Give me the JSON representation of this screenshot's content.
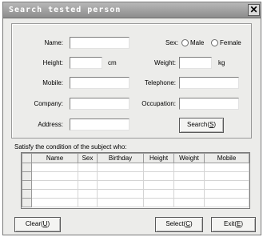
{
  "window": {
    "title": "Search tested person",
    "close_glyph": "✕"
  },
  "form": {
    "name_label": "Name:",
    "name_value": "",
    "sex_label": "Sex:",
    "sex_options": [
      "Male",
      "Female"
    ],
    "height_label": "Height:",
    "height_value": "",
    "height_unit": "cm",
    "weight_label": "Weight:",
    "weight_value": "",
    "weight_unit": "kg",
    "mobile_label": "Mobile:",
    "mobile_value": "",
    "telephone_label": "Telephone:",
    "telephone_value": "",
    "company_label": "Company:",
    "company_value": "",
    "occupation_label": "Occupation:",
    "occupation_value": "",
    "address_label": "Address:",
    "address_value": "",
    "search_button": "Search(S)",
    "search_text": "Search(",
    "search_key": "S",
    "search_end": ")"
  },
  "results": {
    "hint": "Satisfy the condition of the subject who:",
    "columns": [
      "Name",
      "Sex",
      "Birthday",
      "Height",
      "Weight",
      "Mobile"
    ],
    "rows": [
      [
        "",
        "",
        "",
        "",
        "",
        ""
      ],
      [
        "",
        "",
        "",
        "",
        "",
        ""
      ],
      [
        "",
        "",
        "",
        "",
        "",
        ""
      ],
      [
        "",
        "",
        "",
        "",
        "",
        ""
      ],
      [
        "",
        "",
        "",
        "",
        "",
        ""
      ]
    ]
  },
  "footer": {
    "clear_text": "Clear(",
    "clear_key": "U",
    "clear_end": ")",
    "select_text": "Select(",
    "select_key": "C",
    "select_end": ")",
    "exit_text": "Exit(",
    "exit_key": "E",
    "exit_end": ")"
  },
  "colors": {
    "titlebar": "#8c8c8c",
    "window_bg": "#ececea"
  }
}
